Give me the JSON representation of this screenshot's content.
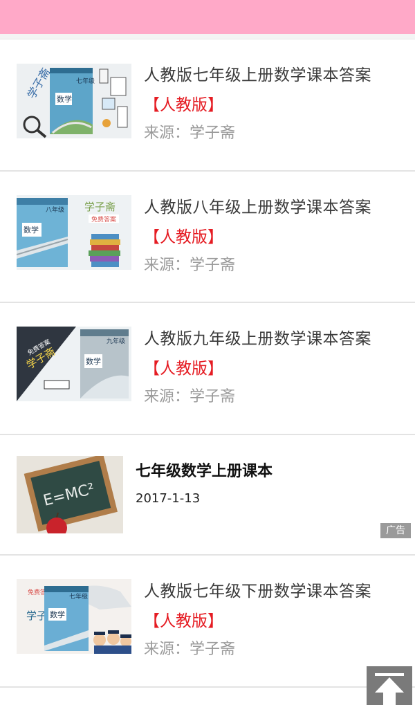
{
  "header": {
    "color": "#ffa9c8"
  },
  "articles": [
    {
      "title": "人教版七年级上册数学课本答案",
      "tag": "【人教版】",
      "source": "来源：学子斋"
    },
    {
      "title": "人教版八年级上册数学课本答案",
      "tag": "【人教版】",
      "source": "来源：学子斋"
    },
    {
      "title": "人教版九年级上册数学课本答案",
      "tag": "【人教版】",
      "source": "来源：学子斋"
    },
    {
      "title": "人教版七年级下册数学课本答案",
      "tag": "【人教版】",
      "source": "来源：学子斋"
    }
  ],
  "ad": {
    "title": "七年级数学上册课本",
    "date": "2017-1-13",
    "badge": "广告"
  },
  "thumbnails": {
    "book1": {
      "cover_title": "七年级",
      "cover_subject": "数学",
      "brand": "学子斋"
    },
    "book2": {
      "cover_title": "八年级",
      "cover_subject": "数学",
      "brand": "学子斋",
      "badge": "免费答案"
    },
    "book3": {
      "cover_title": "九年级",
      "cover_subject": "数学",
      "brand": "学子斋",
      "badge": "免费答案"
    },
    "book4": {
      "cover_title": "七年级",
      "cover_subject": "数学",
      "brand": "学子斋",
      "badge": "免费答案"
    },
    "ad": {
      "formula": "E=MC²"
    }
  },
  "back_to_top": {
    "icon": "arrow-up-icon"
  }
}
